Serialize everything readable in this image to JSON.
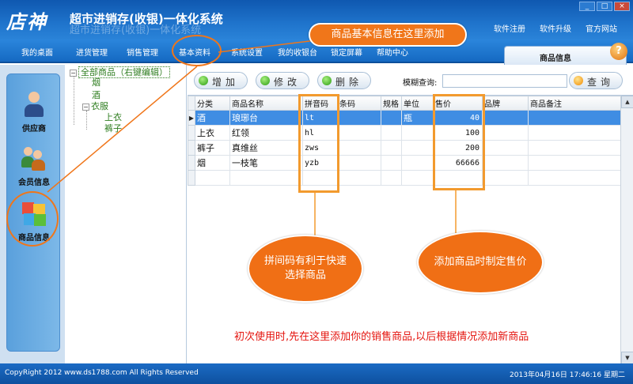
{
  "app": {
    "logo": "店神",
    "title": "超市进销存(收银)一体化系统",
    "title_shadow": "超市进销存(收银)一体化系统"
  },
  "top_links": [
    "软件注册",
    "软件升级",
    "官方网站"
  ],
  "window_controls": [
    "_",
    "□",
    "×"
  ],
  "menu": {
    "items": [
      "我的桌面",
      "进货管理",
      "销售管理",
      "基本资料",
      "系统设置",
      "我的收银台",
      "锁定屏幕",
      "帮助中心"
    ]
  },
  "tab_header": {
    "label": "商品信息",
    "help_icon": "?"
  },
  "sidebar": {
    "items": [
      {
        "label": "供应商",
        "icon": "supplier-icon"
      },
      {
        "label": "会员信息",
        "icon": "member-icon"
      },
      {
        "label": "商品信息",
        "icon": "product-icon"
      }
    ]
  },
  "tree": {
    "root": "全部商品（右键编辑）",
    "root_toggle": "−",
    "nodes": [
      {
        "label": "烟"
      },
      {
        "label": "酒"
      },
      {
        "label": "衣服",
        "toggle": "−"
      },
      {
        "label": "上衣"
      },
      {
        "label": "裤子"
      }
    ]
  },
  "toolbar": {
    "add_label": "增加",
    "edit_label": "修改",
    "delete_label": "删除",
    "search_label": "模糊查询:",
    "search_value": "",
    "search_button": "查询"
  },
  "table": {
    "columns": [
      "分类",
      "商品名称",
      "拼音码",
      "条码",
      "规格",
      "单位",
      "售价",
      "品牌",
      "商品备注"
    ],
    "rows": [
      {
        "category": "酒",
        "name": "琅琊台",
        "pinyin": "lt",
        "barcode": "",
        "spec": "",
        "unit": "瓶",
        "price": "40",
        "brand": "",
        "remark": "",
        "selected": true
      },
      {
        "category": "上衣",
        "name": "红领",
        "pinyin": "hl",
        "barcode": "",
        "spec": "",
        "unit": "",
        "price": "100",
        "brand": "",
        "remark": "",
        "selected": false
      },
      {
        "category": "裤子",
        "name": "真维丝",
        "pinyin": "zws",
        "barcode": "",
        "spec": "",
        "unit": "",
        "price": "200",
        "brand": "",
        "remark": "",
        "selected": false
      },
      {
        "category": "烟",
        "name": "一枝笔",
        "pinyin": "yzb",
        "barcode": "",
        "spec": "",
        "unit": "",
        "price": "66666",
        "brand": "",
        "remark": "",
        "selected": false
      }
    ]
  },
  "annotations": {
    "top_callout": "商品基本信息在这里添加",
    "pinyin_note_1": "拼间码有利于快速",
    "pinyin_note_2": "选择商品",
    "price_note": "添加商品时制定售价",
    "bottom_note": "初次使用时,先在这里添加你的销售商品,以后根据情况添加新商品"
  },
  "status": {
    "copyright": "CopyRight  2012   www.ds1788.com   All  Rights  Reserved",
    "datetime": "2013年04月16日   17:46:16  星期二"
  },
  "colors": {
    "accent_orange": "#f0761a",
    "title_blue": "#1569c2",
    "selection_blue": "#3f8de3",
    "tree_green": "#2e7d1f",
    "note_red": "#e4140e"
  }
}
